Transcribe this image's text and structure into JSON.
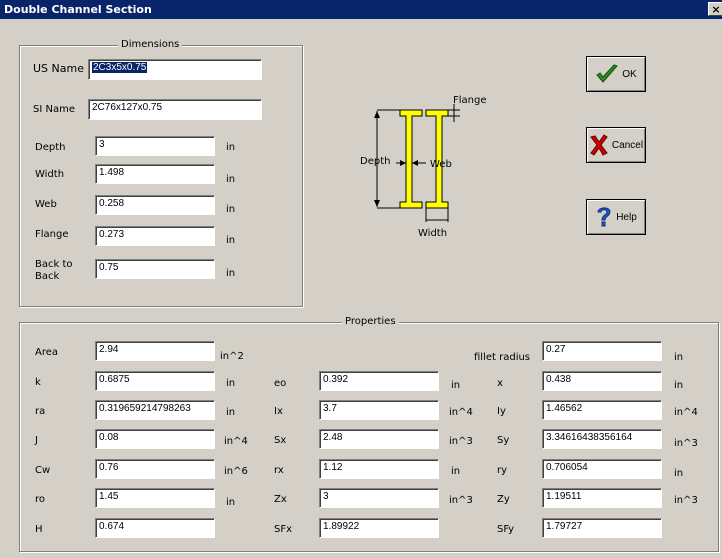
{
  "window": {
    "title": "Double Channel Section",
    "close_label": "×"
  },
  "dimensions": {
    "legend": "Dimensions",
    "us_name": {
      "label": "US Name",
      "value": "2C3x5x0.75"
    },
    "si_name": {
      "label": "SI Name",
      "value": "2C76x127x0.75"
    },
    "depth": {
      "label": "Depth",
      "value": "3",
      "unit": "in"
    },
    "width": {
      "label": "Width",
      "value": "1.498",
      "unit": "in"
    },
    "web": {
      "label": "Web",
      "value": "0.258",
      "unit": "in"
    },
    "flange": {
      "label": "Flange",
      "value": "0.273",
      "unit": "in"
    },
    "back_to_back": {
      "label": "Back to Back",
      "value": "0.75",
      "unit": "in"
    }
  },
  "diagram": {
    "flange": "Flange",
    "depth": "Depth",
    "web": "Web",
    "width": "Width"
  },
  "buttons": {
    "ok": "OK",
    "cancel": "Cancel",
    "help": "Help"
  },
  "properties": {
    "legend": "Properties",
    "area": {
      "label": "Area",
      "value": "2.94",
      "unit": "in^2"
    },
    "fillet_radius": {
      "label": "fillet radius",
      "value": "0.27",
      "unit": "in"
    },
    "k": {
      "label": "k",
      "value": "0.6875",
      "unit": "in"
    },
    "eo": {
      "label": "eo",
      "value": "0.392",
      "unit": "in"
    },
    "x": {
      "label": "x",
      "value": "0.438",
      "unit": "in"
    },
    "ra": {
      "label": "ra",
      "value": "0.319659214798263",
      "unit": "in"
    },
    "ix": {
      "label": "Ix",
      "value": "3.7",
      "unit": "in^4"
    },
    "iy": {
      "label": "Iy",
      "value": "1.46562",
      "unit": "in^4"
    },
    "j": {
      "label": "J",
      "value": "0.08",
      "unit": "in^4"
    },
    "sx": {
      "label": "Sx",
      "value": "2.48",
      "unit": "in^3"
    },
    "sy": {
      "label": "Sy",
      "value": "3.34616438356164",
      "unit": "in^3"
    },
    "cw": {
      "label": "Cw",
      "value": "0.76",
      "unit": "in^6"
    },
    "rx": {
      "label": "rx",
      "value": "1.12",
      "unit": "in"
    },
    "ry": {
      "label": "ry",
      "value": "0.706054",
      "unit": "in"
    },
    "ro": {
      "label": "ro",
      "value": "1.45",
      "unit": "in"
    },
    "zx": {
      "label": "Zx",
      "value": "3",
      "unit": "in^3"
    },
    "zy": {
      "label": "Zy",
      "value": "1.19511",
      "unit": "in^3"
    },
    "h": {
      "label": "H",
      "value": "0.674"
    },
    "sfx": {
      "label": "SFx",
      "value": "1.89922"
    },
    "sfy": {
      "label": "SFy",
      "value": "1.79727"
    }
  },
  "colors": {
    "titlebar": "#0a246a",
    "face": "#d4d0c8",
    "section_fill": "#ffff00",
    "ok_check": "#2e8b22",
    "cancel_x": "#cc0000",
    "help_q": "#1e5bd8"
  }
}
